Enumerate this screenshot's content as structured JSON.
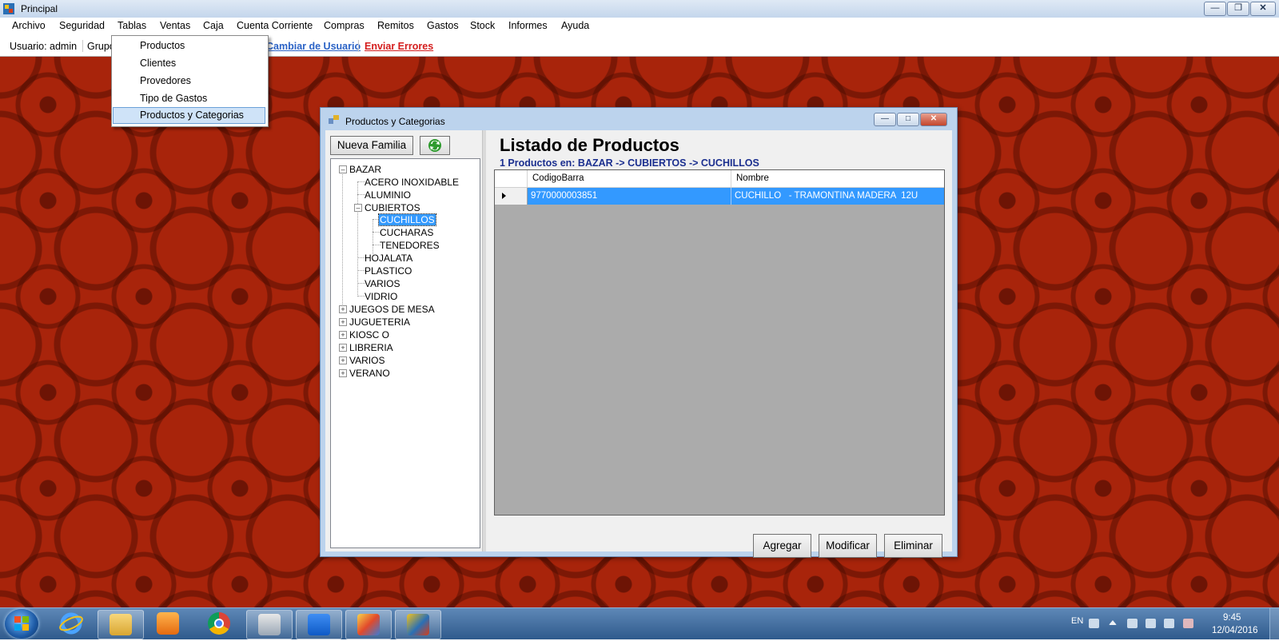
{
  "window": {
    "title": "Principal"
  },
  "menu": {
    "items": [
      "Archivo",
      "Seguridad",
      "Tablas",
      "Ventas",
      "Caja",
      "Cuenta Corriente",
      "Compras",
      "Remitos",
      "Gastos",
      "Stock",
      "Informes",
      "Ayuda"
    ],
    "open_menu": "Tablas",
    "dropdown": [
      "Productos",
      "Clientes",
      "Provedores",
      "Tipo de Gastos",
      "Productos y Categorias"
    ],
    "highlighted_item": "Productos y Categorias"
  },
  "status_strip": {
    "usuario_label": "Usuario:",
    "usuario_value": "admin",
    "grupo_label": "Grupo",
    "cambiar_usuario": "Cambiar de Usuario",
    "enviar_errores": "Enviar Errores"
  },
  "child_window": {
    "title": "Productos y Categorias",
    "nueva_familia_button": "Nueva Familia",
    "refresh_icon": "refresh-arrows-icon",
    "tree": [
      {
        "label": "BAZAR",
        "expanded": true,
        "children": [
          {
            "label": "ACERO INOXIDABLE"
          },
          {
            "label": "ALUMINIO"
          },
          {
            "label": "CUBIERTOS",
            "expanded": true,
            "children": [
              {
                "label": "CUCHILLOS",
                "selected": true
              },
              {
                "label": "CUCHARAS"
              },
              {
                "label": "TENEDORES"
              }
            ]
          },
          {
            "label": "HOJALATA"
          },
          {
            "label": "PLASTICO"
          },
          {
            "label": "VARIOS"
          },
          {
            "label": "VIDRIO"
          }
        ]
      },
      {
        "label": "JUEGOS DE MESA",
        "expanded": false
      },
      {
        "label": "JUGUETERIA",
        "expanded": false
      },
      {
        "label": "KIOSC O",
        "expanded": false
      },
      {
        "label": "LIBRERIA",
        "expanded": false
      },
      {
        "label": "VARIOS",
        "expanded": false
      },
      {
        "label": "VERANO",
        "expanded": false
      }
    ],
    "list_title": "Listado de Productos",
    "list_subtitle": "1 Productos en: BAZAR -> CUBIERTOS  -> CUCHILLOS",
    "grid": {
      "columns": [
        "CodigoBarra",
        "Nombre"
      ],
      "rows": [
        {
          "codigo": "9770000003851",
          "nombre": "CUCHILLO   - TRAMONTINA MADERA  12U",
          "selected": true
        }
      ]
    },
    "buttons": {
      "agregar": "Agregar",
      "modificar": "Modificar",
      "eliminar": "Eliminar"
    }
  },
  "taskbar": {
    "pinned_icons": [
      "windows-explorer-icon",
      "media-player-icon",
      "chrome-icon",
      "tools-icon",
      "teamviewer-icon",
      "app-swirl-icon",
      "gc-app-icon"
    ],
    "language": "EN",
    "time": "9:45",
    "date": "12/04/2016"
  },
  "colors": {
    "desktop_red": "#a8240b",
    "selection_blue": "#3399ff",
    "link_blue": "#2b63c6",
    "link_red": "#d41d1d",
    "subtitle_navy": "#1b2f8f"
  }
}
